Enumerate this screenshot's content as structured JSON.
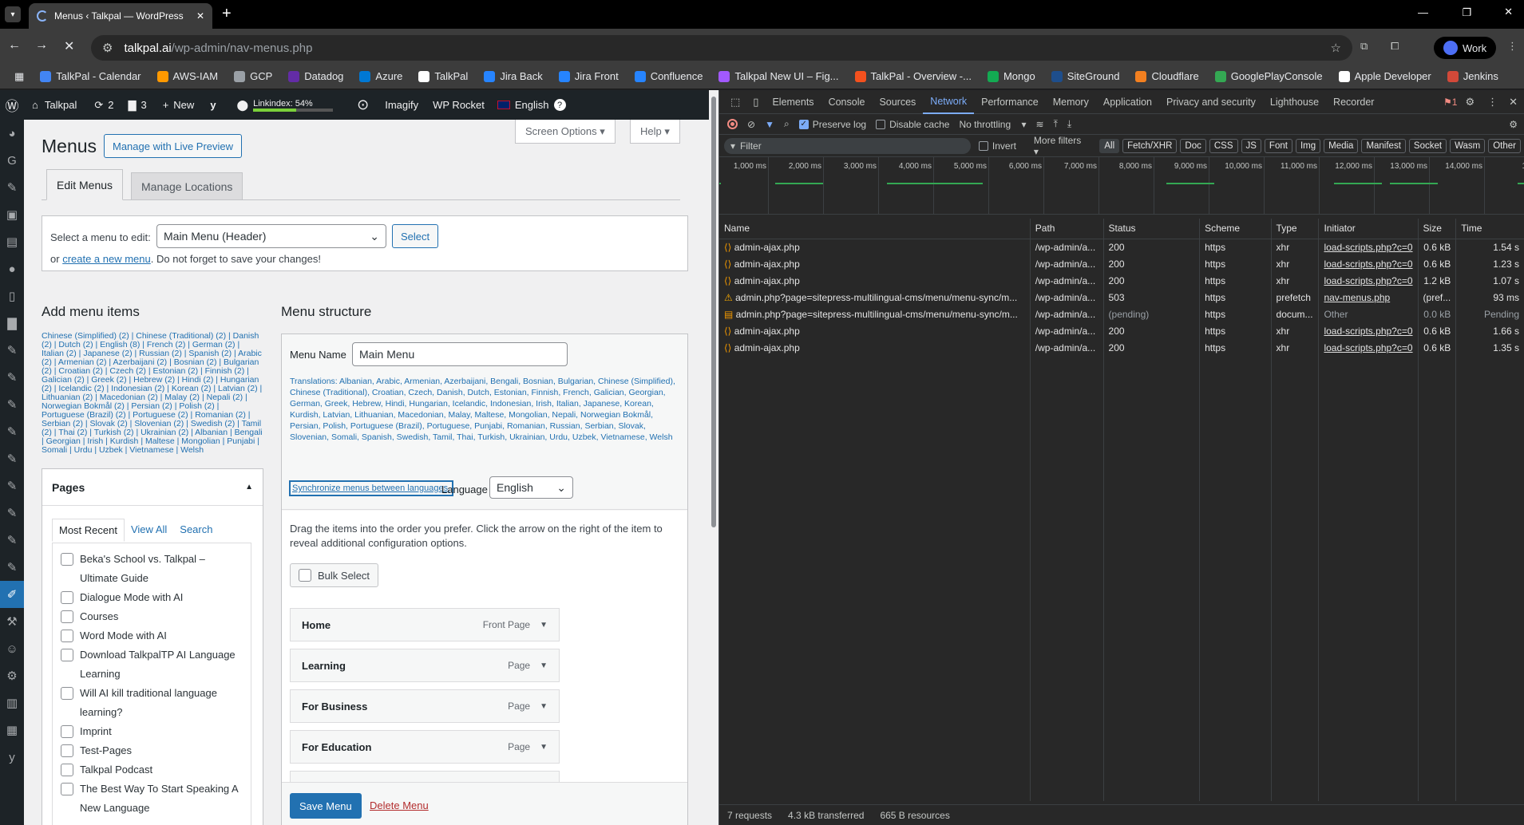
{
  "browser": {
    "tab_title": "Menus ‹ Talkpal — WordPress",
    "url_host": "talkpal.ai",
    "url_path": "/wp-admin/nav-menus.php",
    "profile": "Work",
    "bookmarks": [
      "TalkPal - Calendar",
      "AWS-IAM",
      "GCP",
      "Datadog",
      "Azure",
      "TalkPal",
      "Jira Back",
      "Jira Front",
      "Confluence",
      "Talkpal New UI – Fig...",
      "TalkPal - Overview -...",
      "Mongo",
      "SiteGround",
      "Cloudflare",
      "GooglePlayConsole",
      "Apple Developer",
      "Jenkins"
    ]
  },
  "wp_adminbar": {
    "site": "Talkpal",
    "updates": "2",
    "comments": "3",
    "new": "New",
    "linkindex": "Linkindex: 54%",
    "imagify": "Imagify",
    "wprocket": "WP Rocket",
    "language": "English"
  },
  "wp": {
    "title": "Menus",
    "manage_live": "Manage with Live Preview",
    "screen_options": "Screen Options",
    "help": "Help",
    "tab_edit": "Edit Menus",
    "tab_locations": "Manage Locations",
    "select_label": "Select a menu to edit:",
    "select_value": "Main Menu (Header)",
    "select_btn": "Select",
    "or": "or",
    "create_new": "create a new menu",
    "create_suffix": ". Do not forget to save your changes!",
    "add_items_title": "Add menu items",
    "lang_counts": "Chinese (Simplified) (2) | Chinese (Traditional) (2) | Danish (2) | Dutch (2) | English (8) | French (2) | German (2) | Italian (2) | Japanese (2) | Russian (2) | Spanish (2) | Arabic (2) | Armenian (2) | Azerbaijani (2) | Bosnian (2) | Bulgarian (2) | Croatian (2) | Czech (2) | Estonian (2) | Finnish (2) | Galician (2) | Greek (2) | Hebrew (2) | Hindi (2) | Hungarian (2) | Icelandic (2) | Indonesian (2) | Korean (2) | Latvian (2) | Lithuanian (2) | Macedonian (2) | Malay (2) | Nepali (2) | Norwegian Bokmål (2) | Persian (2) | Polish (2) | Portuguese (Brazil) (2) | Portuguese (2) | Romanian (2) | Serbian (2) | Slovak (2) | Slovenian (2) | Swedish (2) | Tamil (2) | Thai (2) | Turkish (2) | Ukrainian (2) | Albanian | Bengali | Georgian | Irish | Kurdish | Maltese | Mongolian | Punjabi | Somali | Urdu | Uzbek | Vietnamese | Welsh",
    "pages_title": "Pages",
    "pages_tabs": [
      "Most Recent",
      "View All",
      "Search"
    ],
    "pages": [
      "Beka's School vs. Talkpal – Ultimate Guide",
      "Dialogue Mode with AI",
      "Courses",
      "Word Mode with AI",
      "Download TalkpalTP AI Language Learning",
      "Will AI kill traditional language learning?",
      "Imprint",
      "Test-Pages",
      "Talkpal Podcast",
      "The Best Way To Start Speaking A New Language"
    ],
    "structure_title": "Menu structure",
    "menu_name_label": "Menu Name",
    "menu_name_value": "Main Menu",
    "translations": "Translations: Albanian, Arabic, Armenian, Azerbaijani, Bengali, Bosnian, Bulgarian, Chinese (Simplified), Chinese (Traditional), Croatian, Czech, Danish, Dutch, Estonian, Finnish, French, Galician, Georgian, German, Greek, Hebrew, Hindi, Hungarian, Icelandic, Indonesian, Irish, Italian, Japanese, Korean, Kurdish, Latvian, Lithuanian, Macedonian, Malay, Maltese, Mongolian, Nepali, Norwegian Bokmål, Persian, Polish, Portuguese (Brazil), Portuguese, Punjabi, Romanian, Russian, Serbian, Slovak, Slovenian, Somali, Spanish, Swedish, Tamil, Thai, Turkish, Ukrainian, Urdu, Uzbek, Vietnamese, Welsh",
    "sync_btn": "Synchronize menus between languages.",
    "language_label": "Language",
    "language_value": "English",
    "drag_hint": "Drag the items into the order you prefer. Click the arrow on the right of the item to reveal additional configuration options.",
    "bulk_select": "Bulk Select",
    "menu_items": [
      {
        "title": "Home",
        "type": "Front Page"
      },
      {
        "title": "Learning",
        "type": "Page"
      },
      {
        "title": "For Business",
        "type": "Page"
      },
      {
        "title": "For Education",
        "type": "Page"
      }
    ],
    "save_menu": "Save Menu",
    "delete_menu": "Delete Menu"
  },
  "devtools": {
    "tabs": [
      "Elements",
      "Console",
      "Sources",
      "Network",
      "Performance",
      "Memory",
      "Application",
      "Privacy and security",
      "Lighthouse",
      "Recorder"
    ],
    "issues_count": "1",
    "preserve_log": "Preserve log",
    "disable_cache": "Disable cache",
    "throttling": "No throttling",
    "filter_placeholder": "Filter",
    "invert": "Invert",
    "more_filters": "More filters",
    "type_filters": [
      "All",
      "Fetch/XHR",
      "Doc",
      "CSS",
      "JS",
      "Font",
      "Img",
      "Media",
      "Manifest",
      "Socket",
      "Wasm",
      "Other"
    ],
    "timeline_ticks": [
      "1,000 ms",
      "2,000 ms",
      "3,000 ms",
      "4,000 ms",
      "5,000 ms",
      "6,000 ms",
      "7,000 ms",
      "8,000 ms",
      "9,000 ms",
      "10,000 ms",
      "11,000 ms",
      "12,000 ms",
      "13,000 ms",
      "14,000 ms",
      "15,0"
    ],
    "columns": [
      "Name",
      "Path",
      "Status",
      "Scheme",
      "Type",
      "Initiator",
      "Size",
      "Time"
    ],
    "rows": [
      {
        "name": "admin-ajax.php",
        "path": "/wp-admin/a...",
        "status": "200",
        "scheme": "https",
        "type": "xhr",
        "initiator": "load-scripts.php?c=0",
        "size": "0.6 kB",
        "time": "1.54 s"
      },
      {
        "name": "admin-ajax.php",
        "path": "/wp-admin/a...",
        "status": "200",
        "scheme": "https",
        "type": "xhr",
        "initiator": "load-scripts.php?c=0",
        "size": "0.6 kB",
        "time": "1.23 s"
      },
      {
        "name": "admin-ajax.php",
        "path": "/wp-admin/a...",
        "status": "200",
        "scheme": "https",
        "type": "xhr",
        "initiator": "load-scripts.php?c=0",
        "size": "1.2 kB",
        "time": "1.07 s"
      },
      {
        "name": "admin.php?page=sitepress-multilingual-cms/menu/menu-sync/m...",
        "path": "/wp-admin/a...",
        "status": "503",
        "scheme": "https",
        "type": "prefetch",
        "initiator": "nav-menus.php",
        "size": "(pref...",
        "time": "93 ms"
      },
      {
        "name": "admin.php?page=sitepress-multilingual-cms/menu/menu-sync/m...",
        "path": "/wp-admin/a...",
        "status": "(pending)",
        "scheme": "https",
        "type": "docum...",
        "initiator": "Other",
        "size": "0.0 kB",
        "time": "Pending"
      },
      {
        "name": "admin-ajax.php",
        "path": "/wp-admin/a...",
        "status": "200",
        "scheme": "https",
        "type": "xhr",
        "initiator": "load-scripts.php?c=0",
        "size": "0.6 kB",
        "time": "1.66 s"
      },
      {
        "name": "admin-ajax.php",
        "path": "/wp-admin/a...",
        "status": "200",
        "scheme": "https",
        "type": "xhr",
        "initiator": "load-scripts.php?c=0",
        "size": "0.6 kB",
        "time": "1.35 s"
      }
    ],
    "summary_requests": "7 requests",
    "summary_transferred": "4.3 kB transferred",
    "summary_resources": "665 B resources"
  },
  "colors": {
    "accent": "#2271b1",
    "devtools_active": "#7cacf8",
    "warn": "#fdd663",
    "adminbar": "#1d2327"
  }
}
